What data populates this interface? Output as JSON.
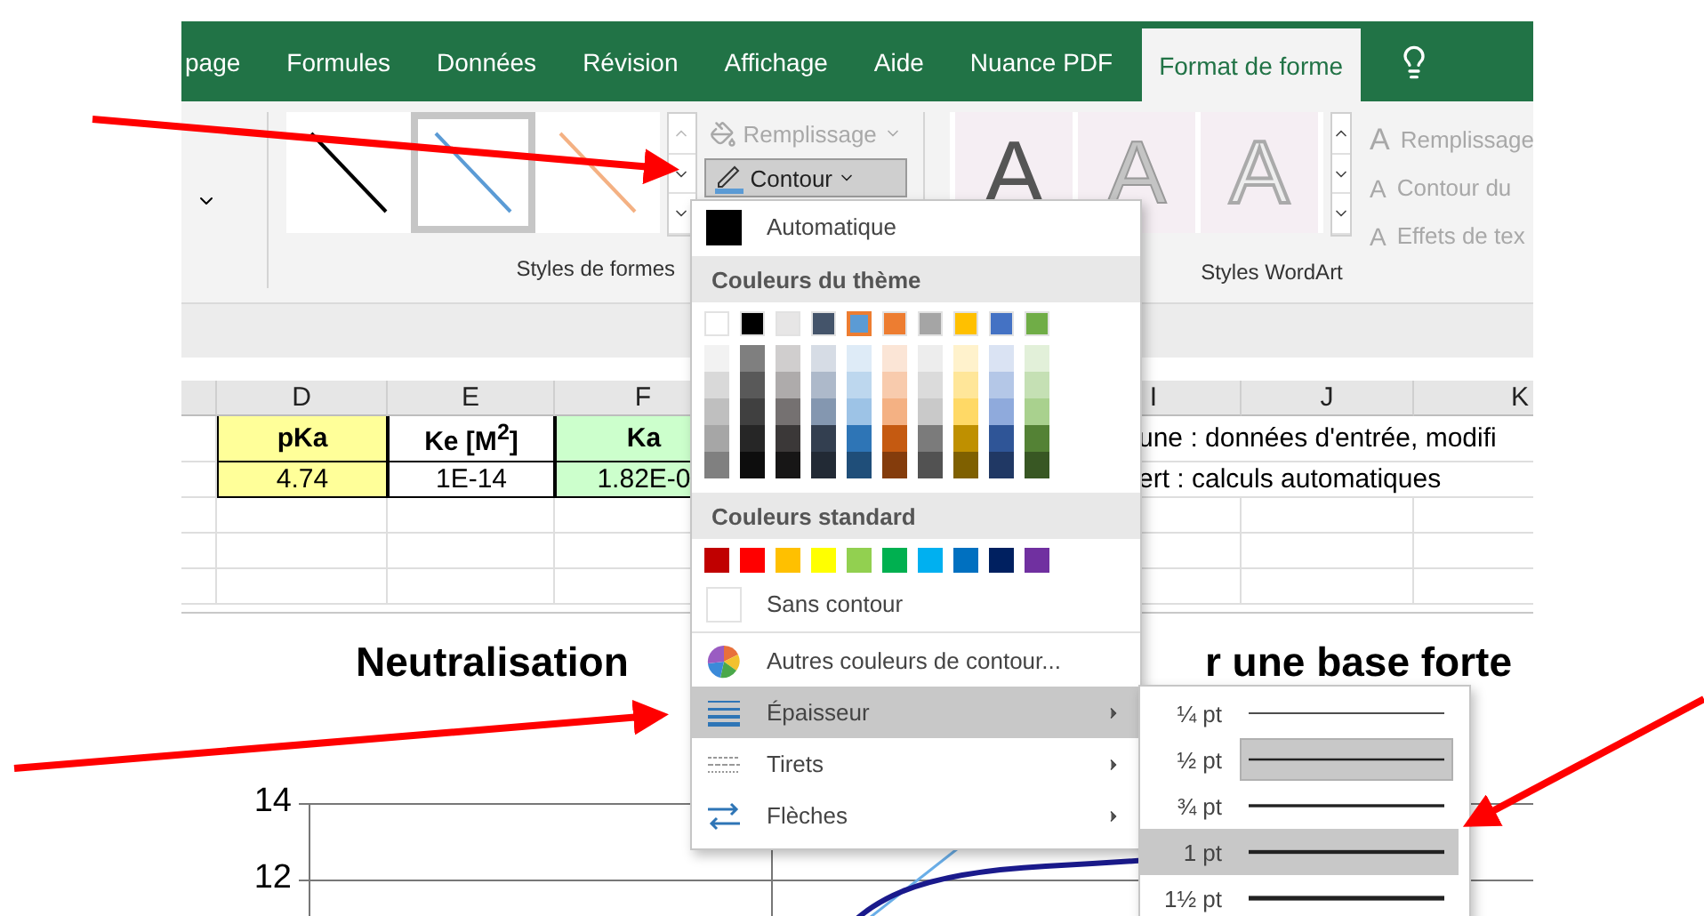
{
  "ribbon_tabs": [
    {
      "label": "page",
      "selected": false
    },
    {
      "label": "Formules",
      "selected": false
    },
    {
      "label": "Données",
      "selected": false
    },
    {
      "label": "Révision",
      "selected": false
    },
    {
      "label": "Affichage",
      "selected": false
    },
    {
      "label": "Aide",
      "selected": false
    },
    {
      "label": "Nuance PDF",
      "selected": false
    },
    {
      "label": "Format de forme",
      "selected": true
    }
  ],
  "shape_styles": {
    "label": "Styles de formes",
    "items": [
      {
        "color": "#000000",
        "selected": false
      },
      {
        "color": "#5b9bd5",
        "selected": true
      },
      {
        "color": "#f4b183",
        "selected": false
      }
    ],
    "fill_button": {
      "label": "Remplissage",
      "disabled": true
    },
    "outline_button": {
      "label": "Contour",
      "pressed": true
    }
  },
  "wordart": {
    "label": "Styles WordArt",
    "items": [
      {
        "letter": "A",
        "kind": "solid"
      },
      {
        "letter": "A",
        "kind": "light"
      },
      {
        "letter": "A",
        "kind": "outline"
      }
    ],
    "buttons": [
      {
        "glyph": "A",
        "label": "Remplissage",
        "disabled": true
      },
      {
        "glyph": "A",
        "label": "Contour du",
        "disabled": true
      },
      {
        "glyph": "A",
        "label": "Effets de tex",
        "disabled": true
      }
    ]
  },
  "sheet": {
    "columns": [
      {
        "label": "D"
      },
      {
        "label": "E"
      },
      {
        "label": "F"
      },
      {
        "label": "I"
      },
      {
        "label": "J"
      },
      {
        "label": "K"
      }
    ],
    "rows": [
      {
        "kind": "header",
        "cells": [
          {
            "text": "pKa",
            "color": "#ffff99"
          },
          {
            "text": "Ke [M$^{2}$]",
            "color": "#ffffff"
          },
          {
            "text": "Ka",
            "color": "#ccffcc"
          }
        ],
        "note": "une : données d'entrée, modifi"
      },
      {
        "kind": "data",
        "cells": [
          {
            "text": "4.74",
            "color": "#ffff99"
          },
          {
            "text": "1E-14",
            "color": "#ffffff"
          },
          {
            "text": "1.82E-0",
            "color": "#ccffcc"
          }
        ],
        "note": "ert : calculs automatiques"
      }
    ]
  },
  "chart": {
    "title_left": "Neutralisation",
    "title_right": "r une base forte",
    "y_labels": [
      "14",
      "12"
    ]
  },
  "outline_menu": {
    "items": [
      {
        "kind": "swatch",
        "label": "Automatique",
        "color": "#000000",
        "hovered": false
      },
      {
        "kind": "theme",
        "label": "Couleurs du thème",
        "colors": [
          {
            "color": "#ffffff",
            "selected": false,
            "shades": [
              {
                "color": "#f2f2f2"
              },
              {
                "color": "#d9d9d9"
              },
              {
                "color": "#bfbfbf"
              },
              {
                "color": "#a6a6a6"
              },
              {
                "color": "#808080"
              }
            ]
          },
          {
            "color": "#000000",
            "selected": false,
            "shades": [
              {
                "color": "#7f7f7f"
              },
              {
                "color": "#595959"
              },
              {
                "color": "#404040"
              },
              {
                "color": "#262626"
              },
              {
                "color": "#0d0d0d"
              }
            ]
          },
          {
            "color": "#e7e6e6",
            "selected": false,
            "shades": [
              {
                "color": "#d0cece"
              },
              {
                "color": "#aeabab"
              },
              {
                "color": "#757171"
              },
              {
                "color": "#3b3838"
              },
              {
                "color": "#171616"
              }
            ]
          },
          {
            "color": "#44546a",
            "selected": false,
            "shades": [
              {
                "color": "#d6dce5"
              },
              {
                "color": "#adb9ca"
              },
              {
                "color": "#8497b0"
              },
              {
                "color": "#333f50"
              },
              {
                "color": "#222a35"
              }
            ]
          },
          {
            "color": "#5b9bd5",
            "selected": true,
            "shades": [
              {
                "color": "#deebf7"
              },
              {
                "color": "#bdd7ee"
              },
              {
                "color": "#9dc3e6"
              },
              {
                "color": "#2e75b6"
              },
              {
                "color": "#1f4e79"
              }
            ]
          },
          {
            "color": "#ed7d31",
            "selected": false,
            "shades": [
              {
                "color": "#fbe5d6"
              },
              {
                "color": "#f8cbad"
              },
              {
                "color": "#f4b183"
              },
              {
                "color": "#c55a11"
              },
              {
                "color": "#843c0c"
              }
            ]
          },
          {
            "color": "#a5a5a5",
            "selected": false,
            "shades": [
              {
                "color": "#ededed"
              },
              {
                "color": "#dbdbdb"
              },
              {
                "color": "#c9c9c9"
              },
              {
                "color": "#7b7b7b"
              },
              {
                "color": "#525252"
              }
            ]
          },
          {
            "color": "#ffc000",
            "selected": false,
            "shades": [
              {
                "color": "#fff2cc"
              },
              {
                "color": "#ffe699"
              },
              {
                "color": "#ffd966"
              },
              {
                "color": "#bf9000"
              },
              {
                "color": "#7f6000"
              }
            ]
          },
          {
            "color": "#4472c4",
            "selected": false,
            "shades": [
              {
                "color": "#dae3f3"
              },
              {
                "color": "#b4c7e7"
              },
              {
                "color": "#8faadc"
              },
              {
                "color": "#2f5597"
              },
              {
                "color": "#203864"
              }
            ]
          },
          {
            "color": "#70ad47",
            "selected": false,
            "shades": [
              {
                "color": "#e2f0d9"
              },
              {
                "color": "#c5e0b4"
              },
              {
                "color": "#a9d18e"
              },
              {
                "color": "#548235"
              },
              {
                "color": "#385723"
              }
            ]
          }
        ]
      },
      {
        "kind": "standard",
        "label": "Couleurs standard",
        "colors": [
          {
            "color": "#c00000"
          },
          {
            "color": "#ff0000"
          },
          {
            "color": "#ffc000"
          },
          {
            "color": "#ffff00"
          },
          {
            "color": "#92d050"
          },
          {
            "color": "#00b050"
          },
          {
            "color": "#00b0f0"
          },
          {
            "color": "#0070c0"
          },
          {
            "color": "#002060"
          },
          {
            "color": "#7030a0"
          }
        ]
      },
      {
        "kind": "none",
        "label": "Sans contour",
        "hovered": false
      },
      {
        "kind": "palette",
        "label": "Autres couleurs de contour...",
        "hovered": false
      },
      {
        "kind": "weight",
        "label": "Épaisseur",
        "hovered": true,
        "submenu": true
      },
      {
        "kind": "dash",
        "label": "Tirets",
        "hovered": false,
        "submenu": true
      },
      {
        "kind": "arrows",
        "label": "Flèches",
        "hovered": false,
        "submenu": true
      }
    ]
  },
  "weight_menu": {
    "items": [
      {
        "label": "¼ pt",
        "selected": false,
        "hovered": false
      },
      {
        "label": "½ pt",
        "selected": true,
        "hovered": false
      },
      {
        "label": "¾ pt",
        "selected": false,
        "hovered": false
      },
      {
        "label": "1 pt",
        "selected": false,
        "hovered": true
      },
      {
        "label": "1½ pt",
        "selected": false,
        "hovered": false
      }
    ]
  }
}
